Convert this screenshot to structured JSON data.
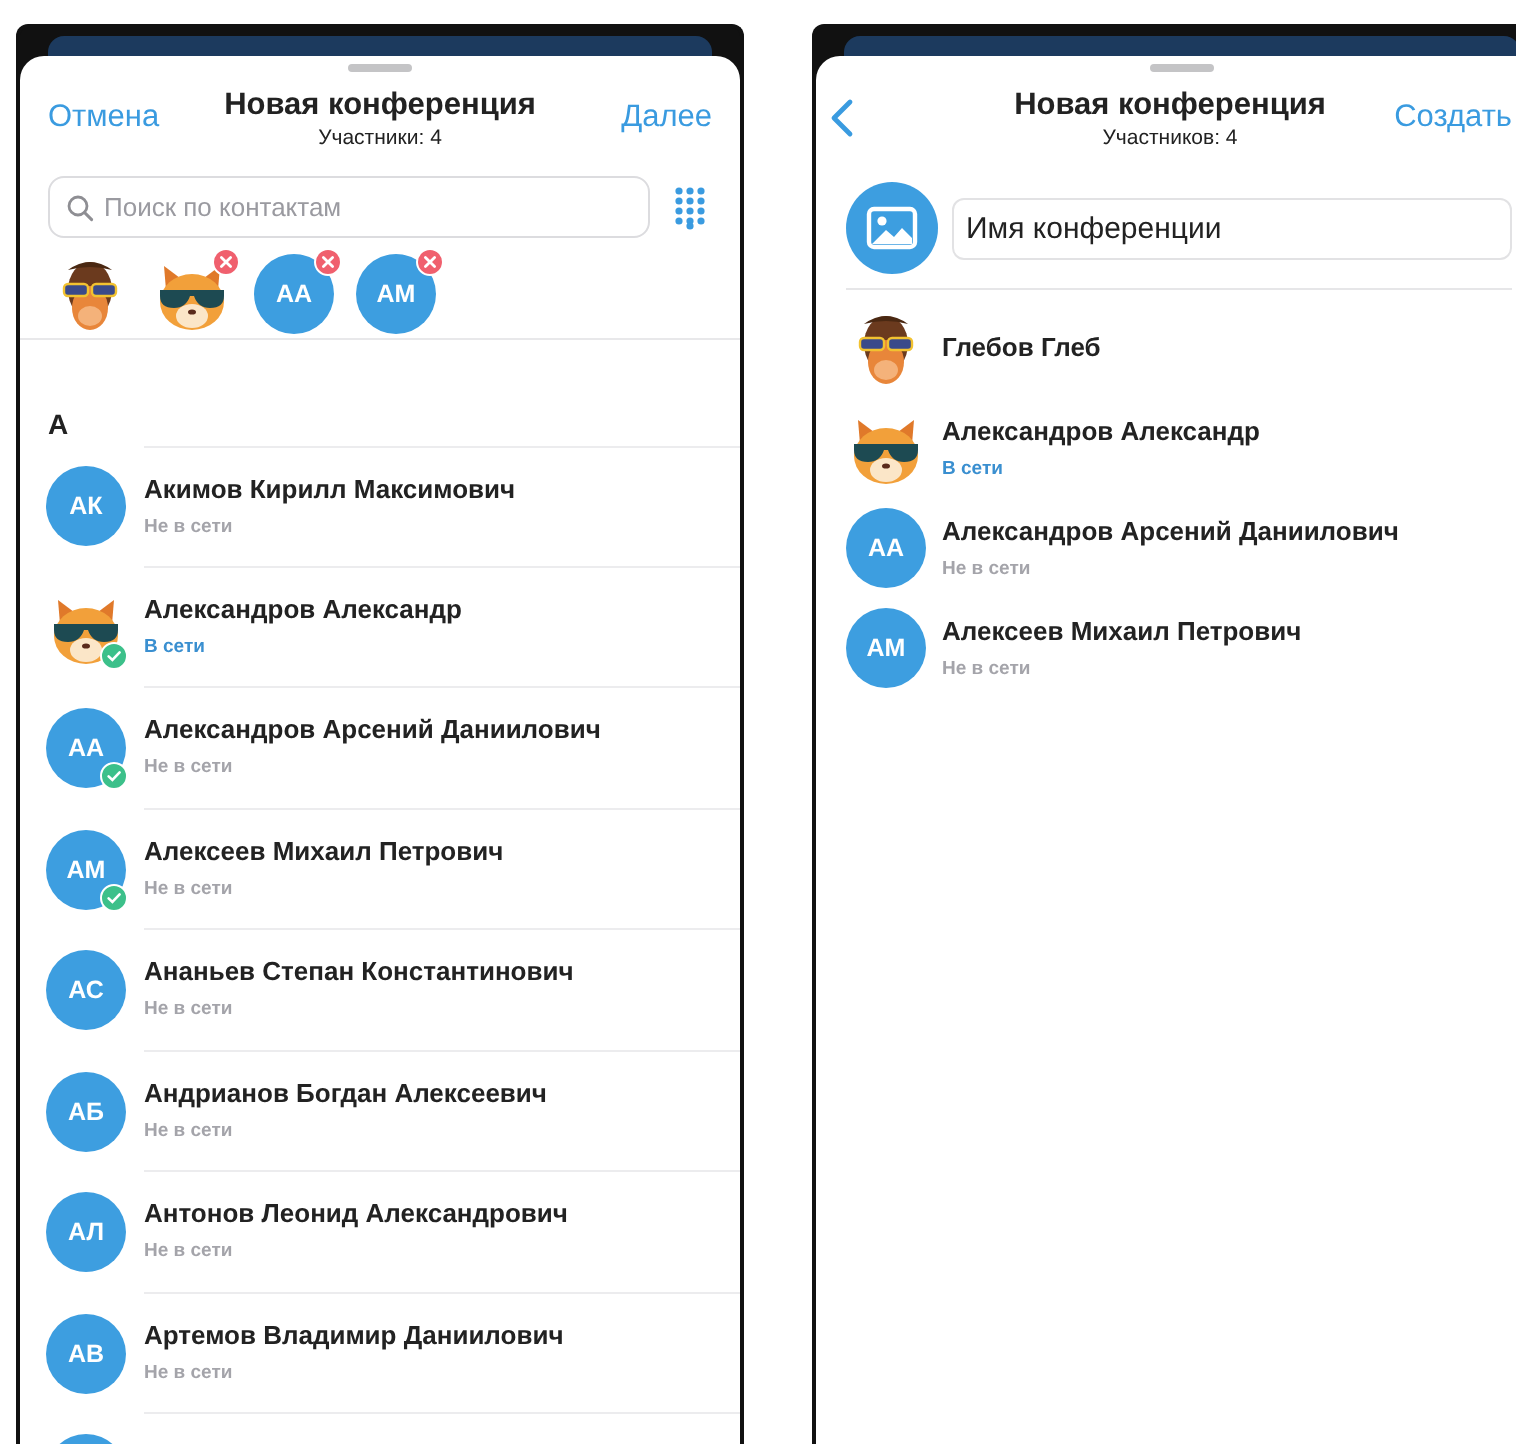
{
  "left": {
    "cancel": "Отмена",
    "title": "Новая конференция",
    "subtitle": "Участники: 4",
    "next": "Далее",
    "search": {
      "placeholder": "Поиск по контактам"
    },
    "chips": [
      {
        "kind": "monkey",
        "removable": false
      },
      {
        "kind": "cat",
        "removable": true
      },
      {
        "kind": "initials",
        "initials": "АА",
        "removable": true
      },
      {
        "kind": "initials",
        "initials": "АМ",
        "removable": true
      }
    ],
    "section": "А",
    "contacts": [
      {
        "kind": "initials",
        "initials": "АК",
        "name": "Акимов Кирилл Максимович",
        "status": "Не в сети",
        "online": false,
        "selected": false
      },
      {
        "kind": "cat",
        "name": "Александров Александр",
        "status": "В сети",
        "online": true,
        "selected": true
      },
      {
        "kind": "initials",
        "initials": "АА",
        "name": "Александров Арсений Даниилович",
        "status": "Не в сети",
        "online": false,
        "selected": true
      },
      {
        "kind": "initials",
        "initials": "АМ",
        "name": "Алексеев Михаил Петрович",
        "status": "Не в сети",
        "online": false,
        "selected": true
      },
      {
        "kind": "initials",
        "initials": "АС",
        "name": "Ананьев Степан Константинович",
        "status": "Не в сети",
        "online": false,
        "selected": false
      },
      {
        "kind": "initials",
        "initials": "АБ",
        "name": "Андрианов Богдан Алексеевич",
        "status": "Не в сети",
        "online": false,
        "selected": false
      },
      {
        "kind": "initials",
        "initials": "АЛ",
        "name": "Антонов Леонид Александрович",
        "status": "Не в сети",
        "online": false,
        "selected": false
      },
      {
        "kind": "initials",
        "initials": "АВ",
        "name": "Артемов Владимир Даниилович",
        "status": "Не в сети",
        "online": false,
        "selected": false
      },
      {
        "kind": "initials"
      }
    ]
  },
  "right": {
    "title": "Новая конференция",
    "subtitle": "Участников: 4",
    "create": "Создать",
    "name_field": {
      "value": "Имя конференции"
    },
    "members": [
      {
        "kind": "monkey",
        "name": "Глебов Глеб"
      },
      {
        "kind": "cat",
        "name": "Александров Александр",
        "status": "В сети",
        "online": true
      },
      {
        "kind": "initials",
        "initials": "АА",
        "name": "Александров Арсений Даниилович",
        "status": "Не в сети",
        "online": false
      },
      {
        "kind": "initials",
        "initials": "АМ",
        "name": "Алексеев Михаил Петрович",
        "status": "Не в сети",
        "online": false
      }
    ]
  }
}
